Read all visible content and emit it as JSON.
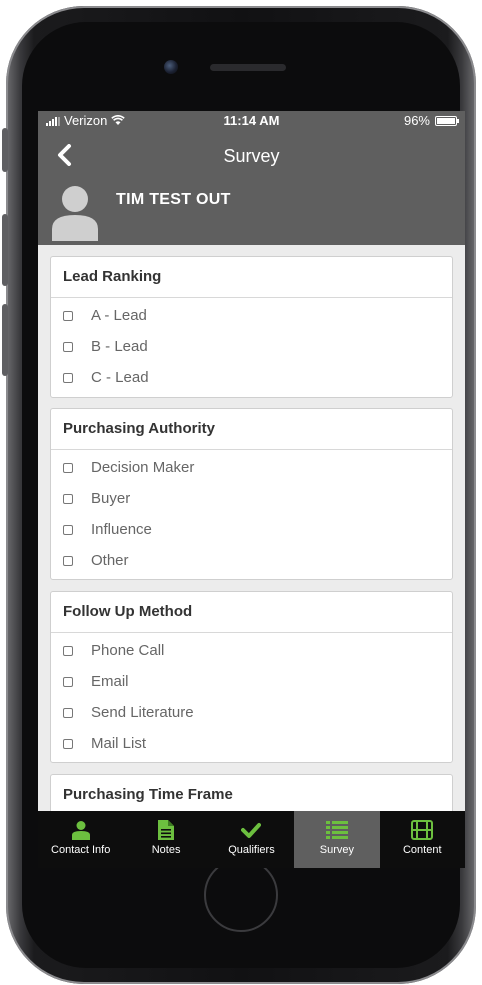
{
  "status_bar": {
    "carrier": "Verizon",
    "time": "11:14 AM",
    "battery": "96%"
  },
  "header": {
    "title": "Survey",
    "contact_name": "TIM TEST OUT"
  },
  "colors": {
    "accent_green": "#6cbf3f",
    "header_gray": "#5f5f5f",
    "tabbar_black": "#0d0d0d"
  },
  "sections": [
    {
      "title": "Lead Ranking",
      "options": [
        "A - Lead",
        "B - Lead",
        "C - Lead"
      ]
    },
    {
      "title": "Purchasing Authority",
      "options": [
        "Decision Maker",
        "Buyer",
        "Influence",
        "Other"
      ]
    },
    {
      "title": "Follow Up Method",
      "options": [
        "Phone Call",
        "Email",
        "Send Literature",
        "Mail List"
      ]
    },
    {
      "title": "Purchasing Time Frame",
      "options": []
    }
  ],
  "tabs": [
    {
      "label": "Contact Info",
      "icon": "person-icon",
      "active": false
    },
    {
      "label": "Notes",
      "icon": "document-icon",
      "active": false
    },
    {
      "label": "Qualifiers",
      "icon": "checkmark-icon",
      "active": false
    },
    {
      "label": "Survey",
      "icon": "list-icon",
      "active": true
    },
    {
      "label": "Content",
      "icon": "film-icon",
      "active": false
    }
  ]
}
